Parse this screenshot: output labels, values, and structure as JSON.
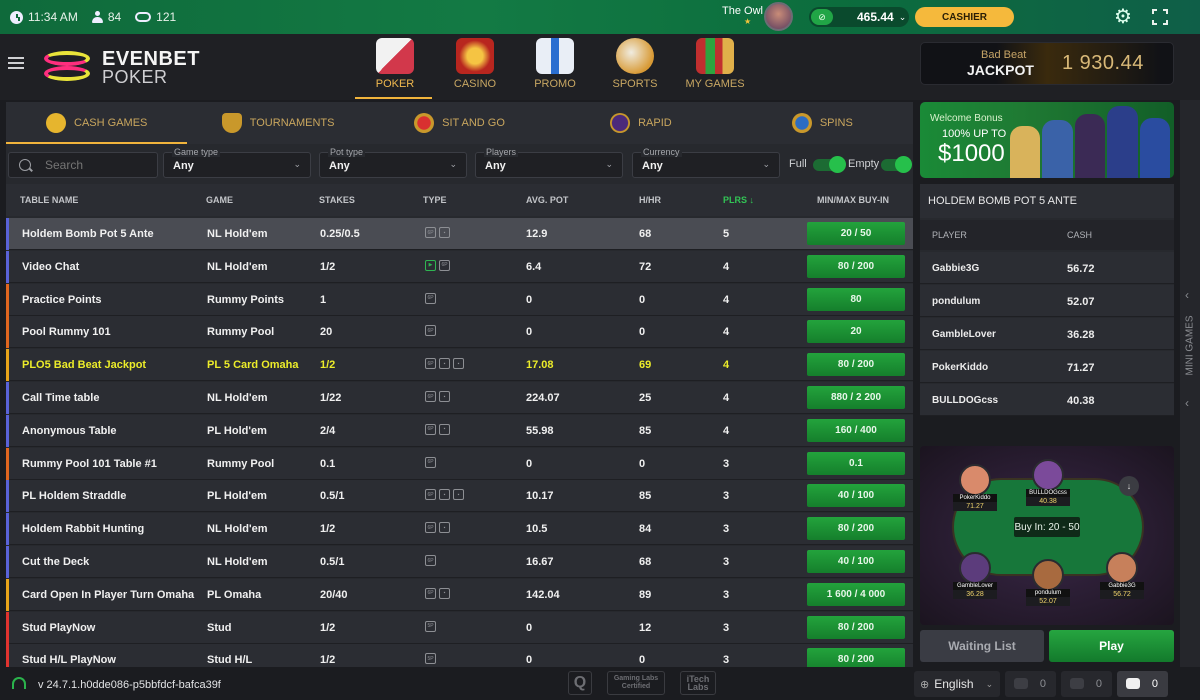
{
  "topbar": {
    "time": "11:34 AM",
    "players_online": "84",
    "tables_count": "121",
    "username": "The Owl",
    "balance": "465.44",
    "cashier_label": "CASHIER"
  },
  "logo": {
    "line1": "EVENBET",
    "line2": "POKER"
  },
  "nav": [
    {
      "label": "POKER",
      "active": true
    },
    {
      "label": "CASINO"
    },
    {
      "label": "PROMO"
    },
    {
      "label": "SPORTS"
    },
    {
      "label": "MY GAMES"
    }
  ],
  "jackpot": {
    "line1": "Bad Beat",
    "line2": "JACKPOT",
    "amount": "1 930.44"
  },
  "game_tabs": [
    {
      "label": "CASH GAMES",
      "active": true
    },
    {
      "label": "TOURNAMENTS"
    },
    {
      "label": "SIT AND GO"
    },
    {
      "label": "RAPID"
    },
    {
      "label": "SPINS"
    }
  ],
  "filters": {
    "search_placeholder": "Search",
    "game_type": {
      "label": "Game type",
      "value": "Any"
    },
    "pot_type": {
      "label": "Pot type",
      "value": "Any"
    },
    "players": {
      "label": "Players",
      "value": "Any"
    },
    "currency": {
      "label": "Currency",
      "value": "Any"
    },
    "full_label": "Full",
    "empty_label": "Empty"
  },
  "table_headers": {
    "name": "TABLE NAME",
    "game": "GAME",
    "stakes": "STAKES",
    "type": "TYPE",
    "avg_pot": "AVG. POT",
    "hhr": "H/HR",
    "plrs": "PLRS ↓",
    "buyin": "MIN/MAX BUY-IN"
  },
  "tables": [
    {
      "name": "Holdem Bomb Pot 5 Ante",
      "game": "NL Hold'em",
      "stakes": "0.25/0.5",
      "types": [
        "6P",
        "bomb"
      ],
      "avg_pot": "12.9",
      "hhr": "68",
      "plrs": "5",
      "buyin": "20 / 50",
      "color": "#5a63d8",
      "selected": true
    },
    {
      "name": "Video Chat",
      "game": "NL Hold'em",
      "stakes": "1/2",
      "types": [
        "video",
        "6P"
      ],
      "avg_pot": "6.4",
      "hhr": "72",
      "plrs": "4",
      "buyin": "80 / 200",
      "color": "#5a63d8"
    },
    {
      "name": "Practice Points",
      "game": "Rummy Points",
      "stakes": "1",
      "types": [
        "6P"
      ],
      "avg_pot": "0",
      "hhr": "0",
      "plrs": "4",
      "buyin": "80",
      "color": "#e0661f"
    },
    {
      "name": "Pool Rummy 101",
      "game": "Rummy Pool",
      "stakes": "20",
      "types": [
        "6P"
      ],
      "avg_pot": "0",
      "hhr": "0",
      "plrs": "4",
      "buyin": "20",
      "color": "#e0661f"
    },
    {
      "name": "PLO5 Bad Beat Jackpot",
      "game": "PL 5 Card Omaha",
      "stakes": "1/2",
      "types": [
        "6P",
        "JP",
        "cards"
      ],
      "avg_pot": "17.08",
      "hhr": "69",
      "plrs": "4",
      "buyin": "80 / 200",
      "color": "#e9a41a",
      "highlight": true
    },
    {
      "name": "Call Time table",
      "game": "NL Hold'em",
      "stakes": "1/22",
      "types": [
        "6P",
        "timer"
      ],
      "avg_pot": "224.07",
      "hhr": "25",
      "plrs": "4",
      "buyin": "880 / 2 200",
      "color": "#5a63d8"
    },
    {
      "name": "Anonymous Table",
      "game": "PL Hold'em",
      "stakes": "2/4",
      "types": [
        "6P",
        "anon"
      ],
      "avg_pot": "55.98",
      "hhr": "85",
      "plrs": "4",
      "buyin": "160 / 400",
      "color": "#5a63d8"
    },
    {
      "name": "Rummy Pool 101 Table #1",
      "game": "Rummy Pool",
      "stakes": "0.1",
      "types": [
        "6P"
      ],
      "avg_pot": "0",
      "hhr": "0",
      "plrs": "3",
      "buyin": "0.1",
      "color": "#e0661f"
    },
    {
      "name": "PL Holdem Straddle",
      "game": "PL Hold'em",
      "stakes": "0.5/1",
      "types": [
        "6P",
        "cards",
        "straddle"
      ],
      "avg_pot": "10.17",
      "hhr": "85",
      "plrs": "3",
      "buyin": "40 / 100",
      "color": "#5a63d8"
    },
    {
      "name": "Holdem Rabbit Hunting",
      "game": "NL Hold'em",
      "stakes": "1/2",
      "types": [
        "6P",
        "rabbit"
      ],
      "avg_pot": "10.5",
      "hhr": "84",
      "plrs": "3",
      "buyin": "80 / 200",
      "color": "#5a63d8"
    },
    {
      "name": "Cut the Deck",
      "game": "NL Hold'em",
      "stakes": "0.5/1",
      "types": [
        "6P"
      ],
      "avg_pot": "16.67",
      "hhr": "68",
      "plrs": "3",
      "buyin": "40 / 100",
      "color": "#5a63d8"
    },
    {
      "name": "Card Open In Player Turn Omaha",
      "game": "PL Omaha",
      "stakes": "20/40",
      "types": [
        "6P",
        "cards"
      ],
      "avg_pot": "142.04",
      "hhr": "89",
      "plrs": "3",
      "buyin": "1 600 / 4 000",
      "color": "#e9a41a"
    },
    {
      "name": "Stud PlayNow",
      "game": "Stud",
      "stakes": "1/2",
      "types": [
        "5P"
      ],
      "avg_pot": "0",
      "hhr": "12",
      "plrs": "3",
      "buyin": "80 / 200",
      "color": "#e0332f"
    },
    {
      "name": "Stud H/L PlayNow",
      "game": "Stud H/L",
      "stakes": "1/2",
      "types": [
        "5P"
      ],
      "avg_pot": "0",
      "hhr": "0",
      "plrs": "3",
      "buyin": "80 / 200",
      "color": "#e0332f"
    }
  ],
  "promo": {
    "line1": "Welcome Bonus",
    "line2": "100% UP TO",
    "line3": "$1000"
  },
  "selected_table": {
    "title": "HOLDEM BOMB POT 5 ANTE",
    "col_player": "PLAYER",
    "col_cash": "CASH",
    "players": [
      {
        "name": "Gabbie3G",
        "cash": "56.72"
      },
      {
        "name": "pondulum",
        "cash": "52.07"
      },
      {
        "name": "GambleLover",
        "cash": "36.28"
      },
      {
        "name": "PokerKiddo",
        "cash": "71.27"
      },
      {
        "name": "BULLDOGcss",
        "cash": "40.38"
      }
    ],
    "buy_in_text": "Buy In: 20 - 50",
    "waiting_list_label": "Waiting List",
    "play_label": "Play"
  },
  "rail": {
    "label": "MINI GAMES"
  },
  "footer": {
    "version": "v 24.7.1.h0dde086-p5bbfdcf-bafca39f",
    "certs": [
      "Q",
      "Gaming Labs Certified",
      "iTech Labs"
    ],
    "language": "English",
    "counter_tables": "0",
    "counter_tournaments": "0",
    "counter_chat": "0"
  }
}
